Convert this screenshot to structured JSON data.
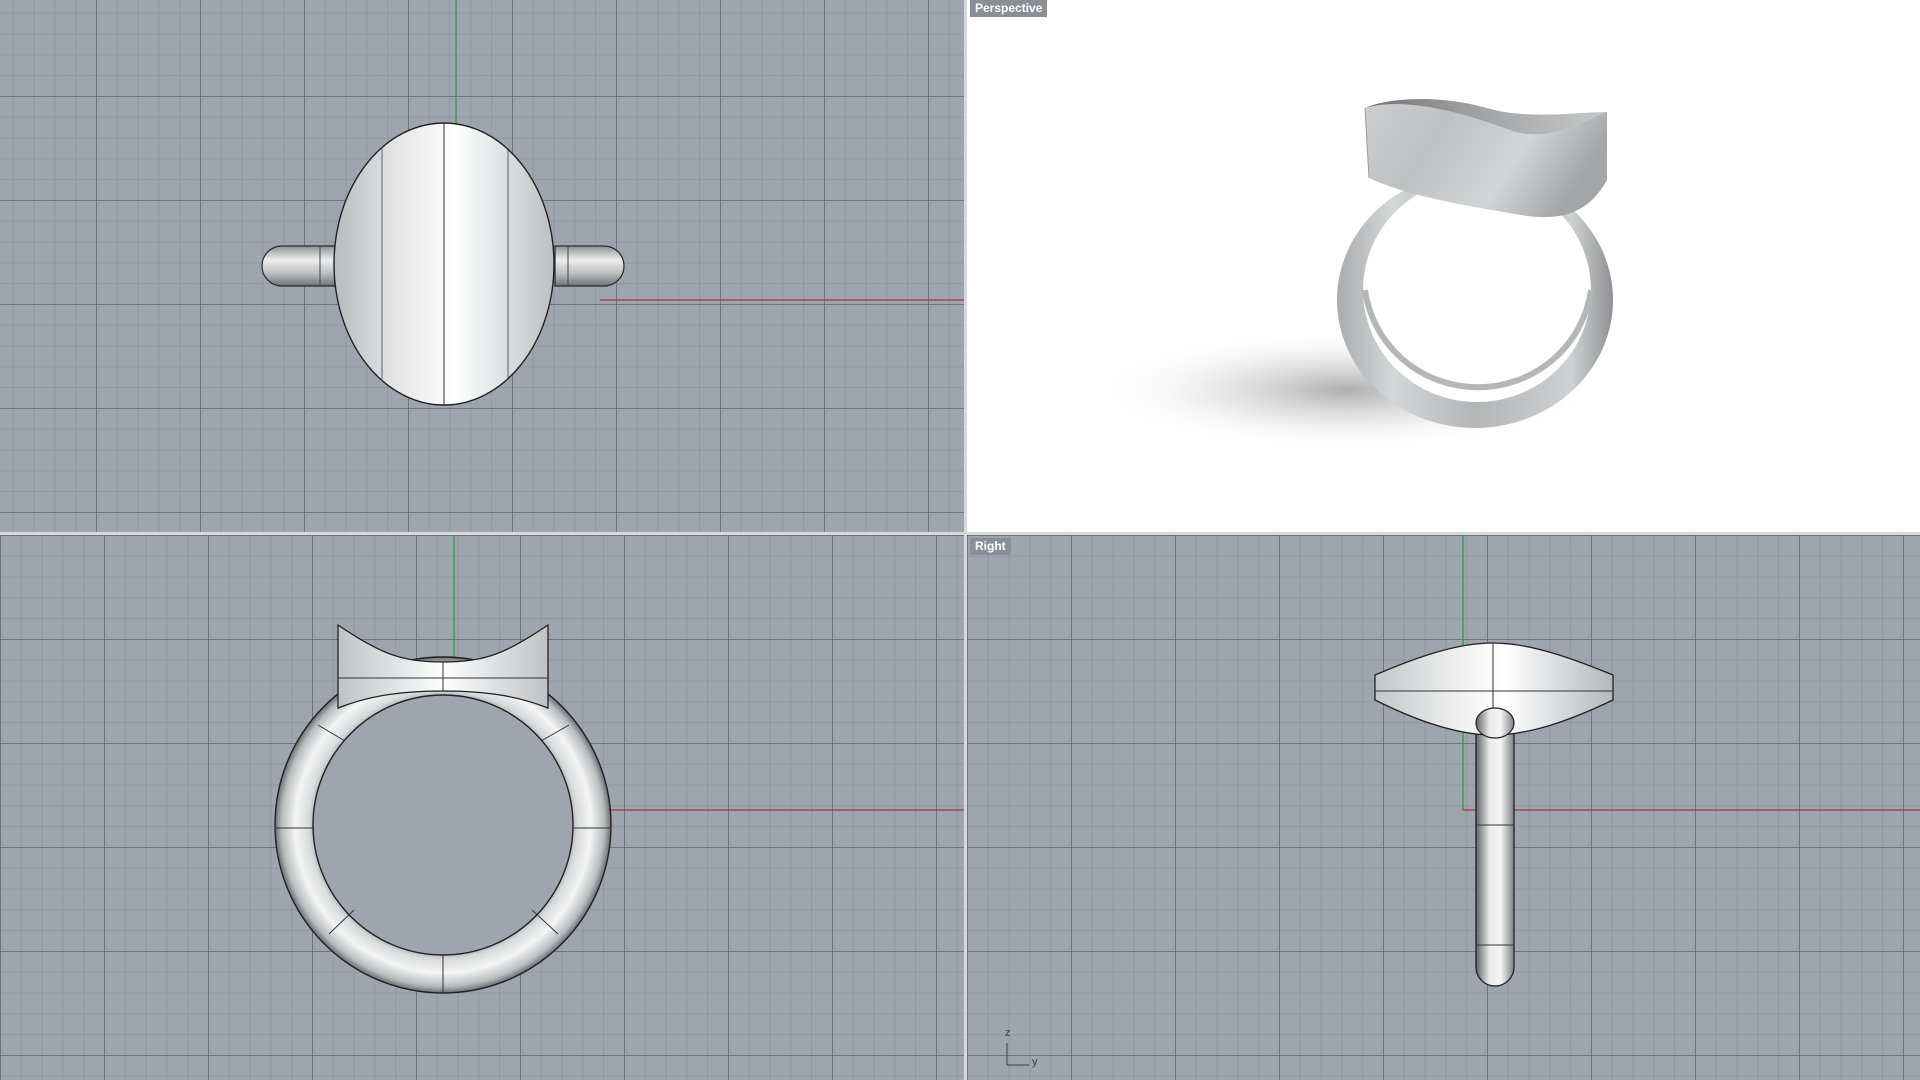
{
  "viewports": {
    "top": {
      "label": ""
    },
    "perspective": {
      "label": "Perspective"
    },
    "front": {
      "label": ""
    },
    "right": {
      "label": "Right"
    }
  },
  "axis_widget": {
    "z": "z",
    "y": "y"
  },
  "colors": {
    "grid_bg": "#9ea5ae",
    "x_axis": "#b3333b",
    "y_axis": "#2c9a42",
    "perspective_bg": "#ffffff",
    "separator": "#d8d8d8"
  }
}
